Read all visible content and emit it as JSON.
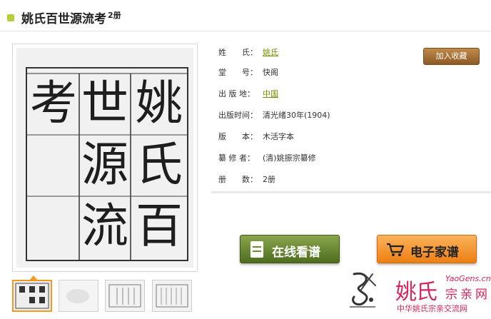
{
  "page": {
    "title": "姚氏百世源流考",
    "volume_count": "2册"
  },
  "book_cover": {
    "characters": [
      "姚",
      "氏",
      "百",
      "世",
      "源",
      "流",
      "考"
    ]
  },
  "details": [
    {
      "label": "姓　　氏：",
      "value": "姚氏",
      "is_link": true
    },
    {
      "label": "堂　　号：",
      "value": "快阁",
      "is_link": false
    },
    {
      "label": "出 版 地：",
      "value": "中国",
      "is_link": true
    },
    {
      "label": "出版时间：",
      "value": "清光绪30年(1904)",
      "is_link": false
    },
    {
      "label": "版　　本：",
      "value": "木活字本",
      "is_link": false
    },
    {
      "label": "纂 修 者：",
      "value": "(清)姚振宗纂修",
      "is_link": false
    },
    {
      "label": "册　　数：",
      "value": "2册",
      "is_link": false
    }
  ],
  "actions": {
    "favorite": "加入收藏",
    "read_online": "在线看谱",
    "digital_genealogy": "电子家谱"
  },
  "brand": {
    "name": "姚氏",
    "url": "YaoGens.cn",
    "site_label": "宗亲网",
    "tagline": "中华姚氏宗亲交流网"
  },
  "colors": {
    "accent_green": "#b5cf3a",
    "link_green": "#7a8f00",
    "brand_pink": "#d8245a",
    "cta_orange": "#ee7f12"
  }
}
